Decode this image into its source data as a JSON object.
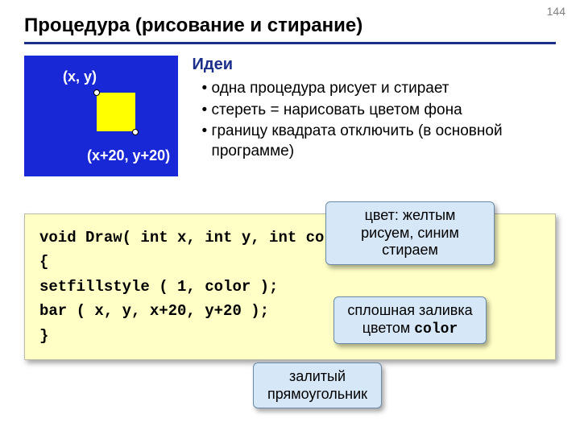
{
  "page_number": "144",
  "title": "Процедура (рисование и стирание)",
  "diagram": {
    "coord_a": "(x, y)",
    "coord_b": "(x+20, y+20)"
  },
  "ideas": {
    "heading": "Идеи",
    "items": [
      "одна процедура рисует и стирает",
      "стереть = нарисовать цветом фона",
      "границу квадрата отключить (в основной программе)"
    ]
  },
  "code": {
    "line1": "void Draw( int x, int y, int color )",
    "line2": "{",
    "line3": "setfillstyle ( 1, color );",
    "line4": "bar ( x, y, x+20, y+20 );",
    "line5": "}"
  },
  "callouts": {
    "c1": "цвет: желтым рисуем, синим стираем",
    "c2a": "сплошная заливка цветом ",
    "c2b": "color",
    "c3": "залитый прямоугольник"
  }
}
